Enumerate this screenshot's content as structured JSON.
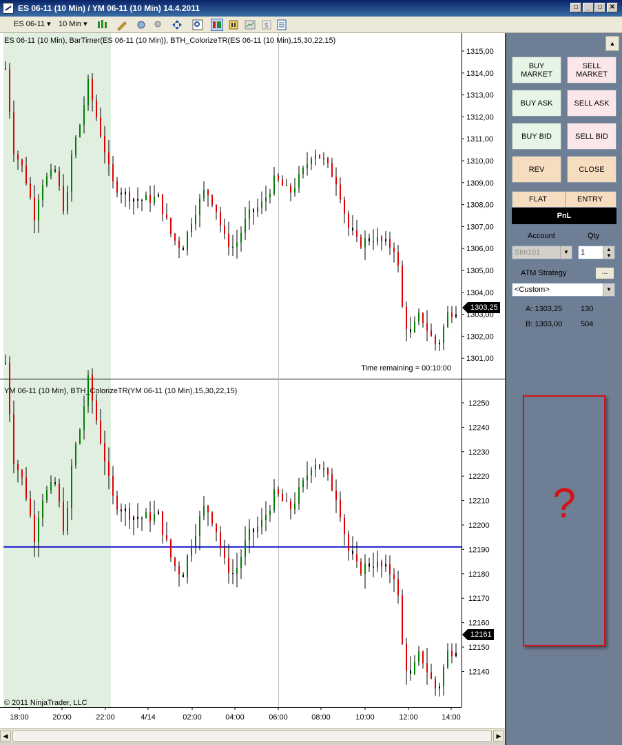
{
  "window": {
    "title": "ES 06-11 (10 Min) / YM 06-11 (10 Min)  14.4.2011",
    "buttons": [
      "_",
      "□",
      "✕",
      "□"
    ]
  },
  "toolbar": {
    "instrument": "ES 06-11",
    "interval": "10 Min"
  },
  "chart_top": {
    "label": "ES 06-11 (10 Min), BarTimer(ES 06-11 (10 Min)), BTH_ColorizeTR(ES 06-11 (10 Min),15,30,22,15)",
    "y_ticks": [
      "1315,00",
      "1314,00",
      "1313,00",
      "1312,00",
      "1311,00",
      "1310,00",
      "1309,00",
      "1308,00",
      "1307,00",
      "1306,00",
      "1305,00",
      "1304,00",
      "1303,00",
      "1302,00",
      "1301,00"
    ],
    "last_price": "1303,25",
    "timer_text": "Time remaining = 00:10:00"
  },
  "chart_bottom": {
    "label": "YM 06-11 (10 Min), BTH_ColorizeTR(YM 06-11 (10 Min),15,30,22,15)",
    "y_ticks": [
      "12250",
      "12240",
      "12230",
      "12220",
      "12210",
      "12200",
      "12190",
      "12180",
      "12170",
      "12160",
      "12150",
      "12140"
    ],
    "last_price": "12161",
    "horizontal_line_value": 12191
  },
  "x_axis": {
    "labels": [
      "18:00",
      "20:00",
      "22:00",
      "4/14",
      "02:00",
      "04:00",
      "06:00",
      "08:00",
      "10:00",
      "12:00",
      "14:00"
    ]
  },
  "copyright": "© 2011 NinjaTrader, LLC",
  "colors": {
    "up_bar": "#008000",
    "down_bar": "#e00000",
    "neutral_bar": "#000000",
    "session_shade": "#e1efe1",
    "level_line": "#1c1cd0",
    "panel_bg": "#6e7e94",
    "question_mark": "#d51010"
  },
  "order_panel": {
    "buttons": {
      "buy_market": "BUY MARKET",
      "sell_market": "SELL MARKET",
      "buy_ask": "BUY ASK",
      "sell_ask": "SELL ASK",
      "buy_bid": "BUY BID",
      "sell_bid": "SELL BID",
      "rev": "REV",
      "close": "CLOSE"
    },
    "position": {
      "flat": "FLAT",
      "entry": "ENTRY",
      "pnl": "PnL"
    },
    "account_label": "Account",
    "qty_label": "Qty",
    "account_value": "Sim101",
    "qty_value": "1",
    "atm_label": "ATM Strategy",
    "atm_button": "...",
    "atm_value": "<Custom>",
    "ask": {
      "label": "A:",
      "price": "1303,25",
      "size": "130"
    },
    "bid": {
      "label": "B:",
      "price": "1303,00",
      "size": "504"
    },
    "placeholder": "?"
  }
}
